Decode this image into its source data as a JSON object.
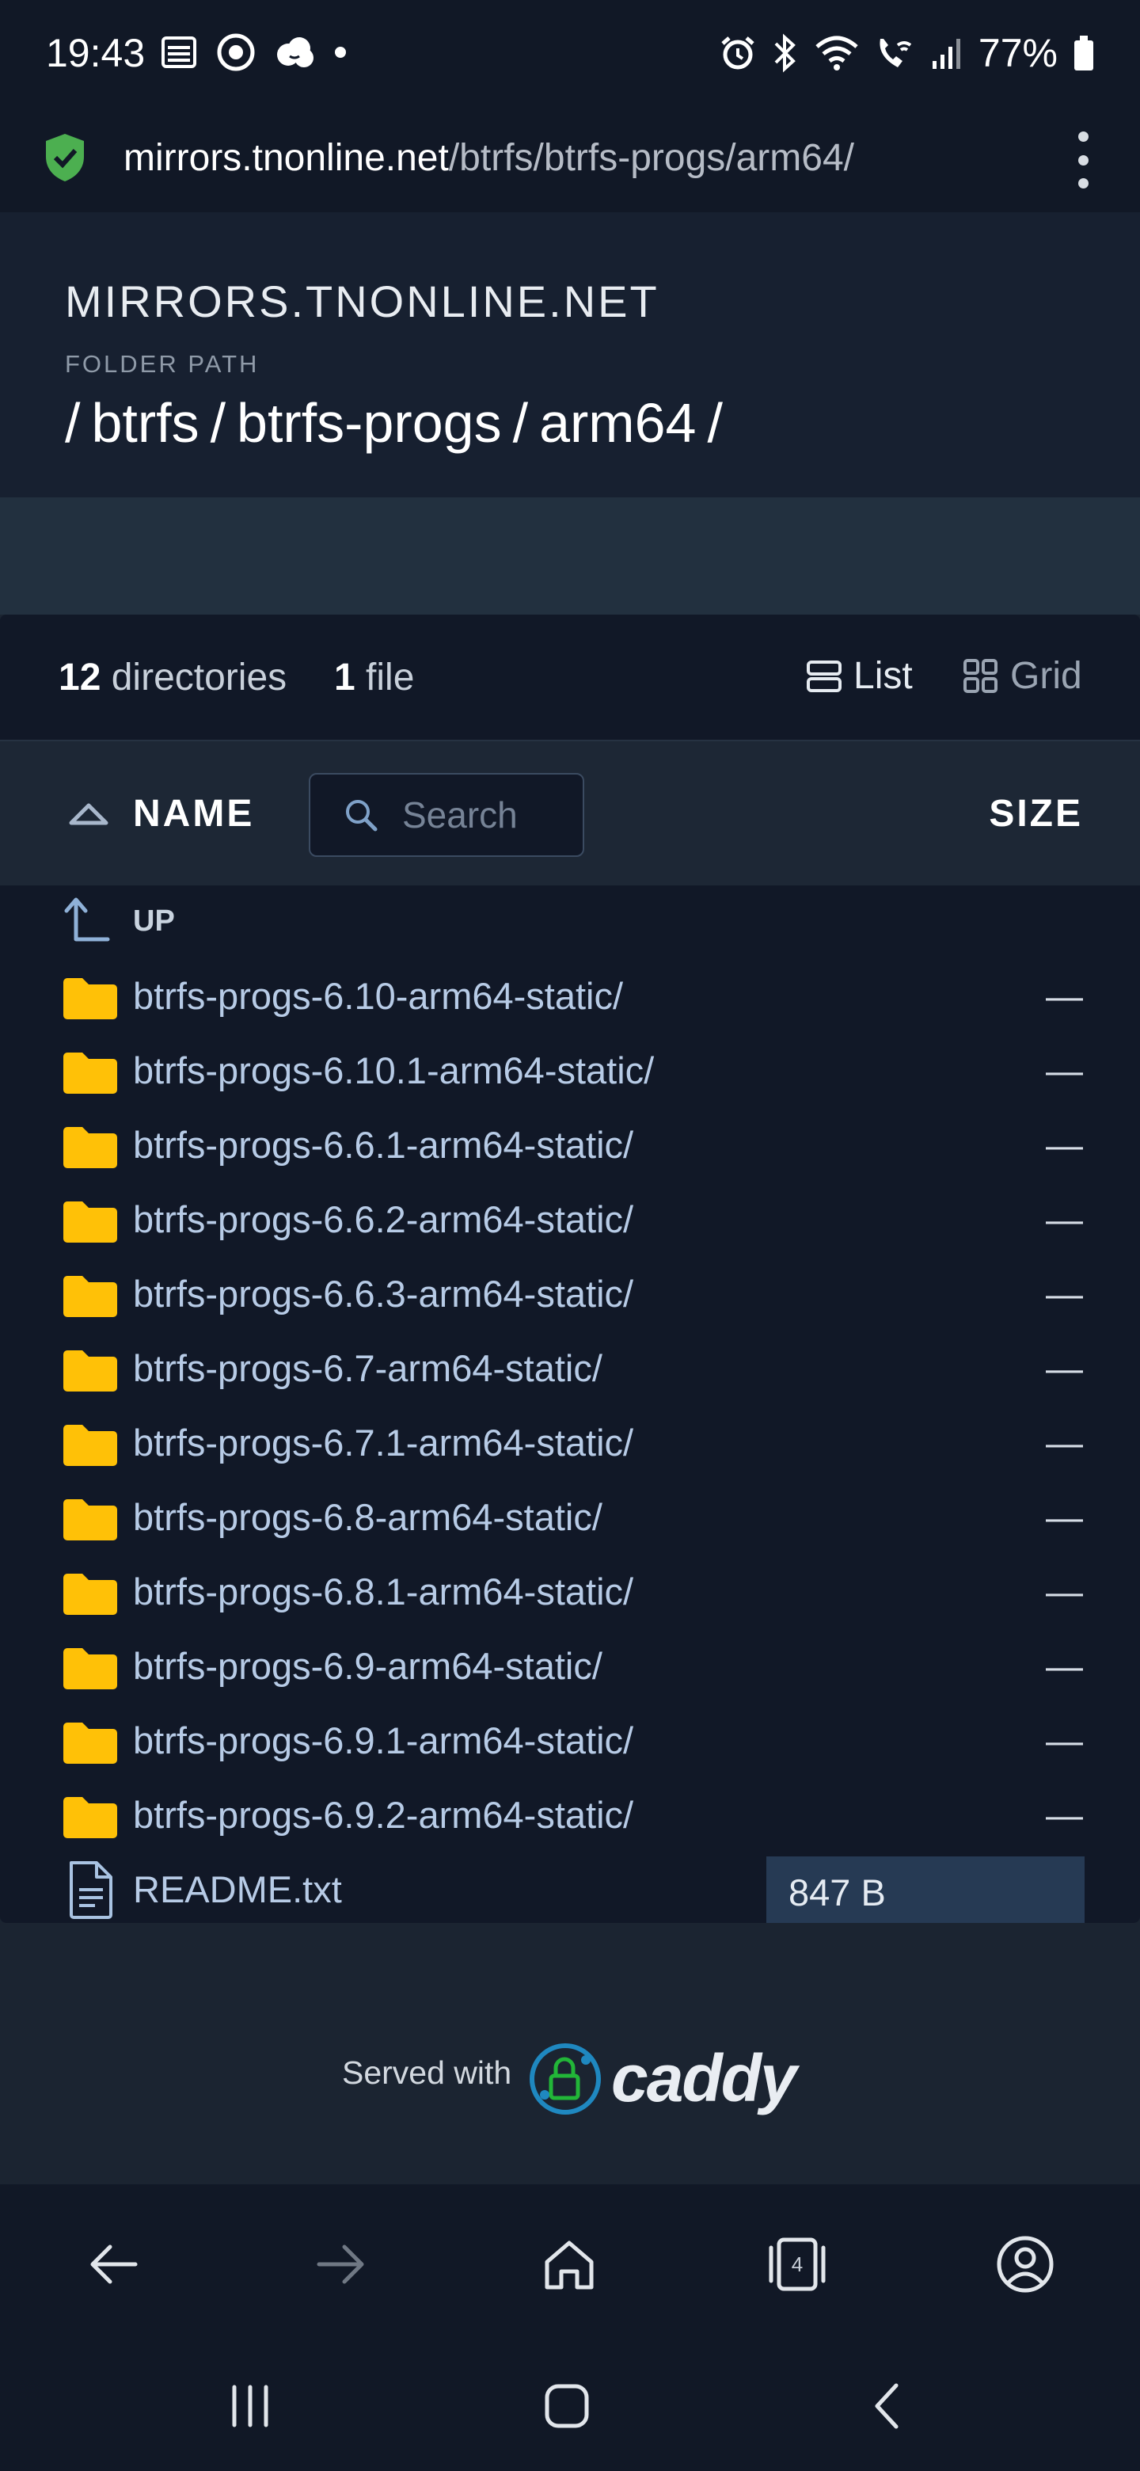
{
  "status_bar": {
    "time": "19:43",
    "battery": "77%",
    "left_icons": [
      "vpn-key-icon",
      "circle-icon",
      "cloud-icon",
      "dot-icon"
    ],
    "right_icons": [
      "alarm-icon",
      "bluetooth-icon",
      "wifi-icon",
      "wifi-calling-icon",
      "signal-icon",
      "battery-icon"
    ]
  },
  "url_bar": {
    "host": "mirrors.tnonline.net",
    "path": "/btrfs/btrfs-progs/arm64/"
  },
  "header": {
    "site_title": "MIRRORS.TNONLINE.NET",
    "folder_label": "FOLDER PATH",
    "breadcrumb": [
      "/",
      "btrfs",
      "/",
      "btrfs-progs",
      "/",
      "arm64",
      "/"
    ]
  },
  "summary": {
    "dir_count": "12",
    "dir_label": "directories",
    "file_count": "1",
    "file_label": "file",
    "list_label": "List",
    "grid_label": "Grid"
  },
  "table": {
    "name_header": "NAME",
    "search_placeholder": "Search",
    "size_header": "SIZE",
    "up_label": "UP",
    "rows": [
      {
        "name": "btrfs-progs-6.10-arm64-static/",
        "size": "—"
      },
      {
        "name": "btrfs-progs-6.10.1-arm64-static/",
        "size": "—"
      },
      {
        "name": "btrfs-progs-6.6.1-arm64-static/",
        "size": "—"
      },
      {
        "name": "btrfs-progs-6.6.2-arm64-static/",
        "size": "—"
      },
      {
        "name": "btrfs-progs-6.6.3-arm64-static/",
        "size": "—"
      },
      {
        "name": "btrfs-progs-6.7-arm64-static/",
        "size": "—"
      },
      {
        "name": "btrfs-progs-6.7.1-arm64-static/",
        "size": "—"
      },
      {
        "name": "btrfs-progs-6.8-arm64-static/",
        "size": "—"
      },
      {
        "name": "btrfs-progs-6.8.1-arm64-static/",
        "size": "—"
      },
      {
        "name": "btrfs-progs-6.9-arm64-static/",
        "size": "—"
      },
      {
        "name": "btrfs-progs-6.9.1-arm64-static/",
        "size": "—"
      },
      {
        "name": "btrfs-progs-6.9.2-arm64-static/",
        "size": "—"
      }
    ],
    "file": {
      "name": "README.txt",
      "size": "847 B"
    }
  },
  "footer": {
    "served_with": "Served with",
    "brand": "caddy"
  },
  "browser_nav": {
    "tab_count": "4"
  },
  "colors": {
    "folder": "#ffc107",
    "link": "#b7cbe6",
    "shield": "#4caf50",
    "caddy_blue": "#1f88c0",
    "caddy_green": "#22b638"
  }
}
